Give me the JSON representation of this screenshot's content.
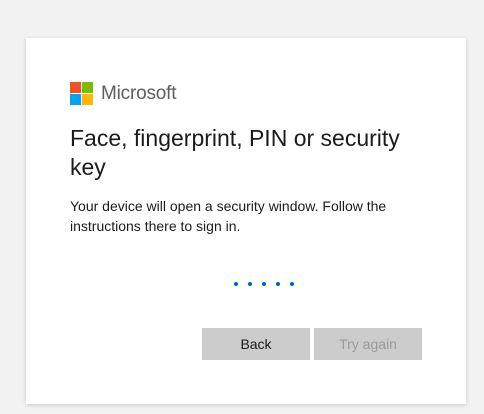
{
  "brand": {
    "name": "Microsoft",
    "logo_colors": [
      "#f25022",
      "#7fba00",
      "#00a4ef",
      "#ffb900"
    ]
  },
  "heading": "Face, fingerprint, PIN or security key",
  "description": "Your device will open a security window. Follow the instructions there to sign in.",
  "progress": {
    "dot_color": "#0067b8",
    "dot_count": 5
  },
  "buttons": {
    "back_label": "Back",
    "try_again_label": "Try again",
    "try_again_disabled": true
  }
}
